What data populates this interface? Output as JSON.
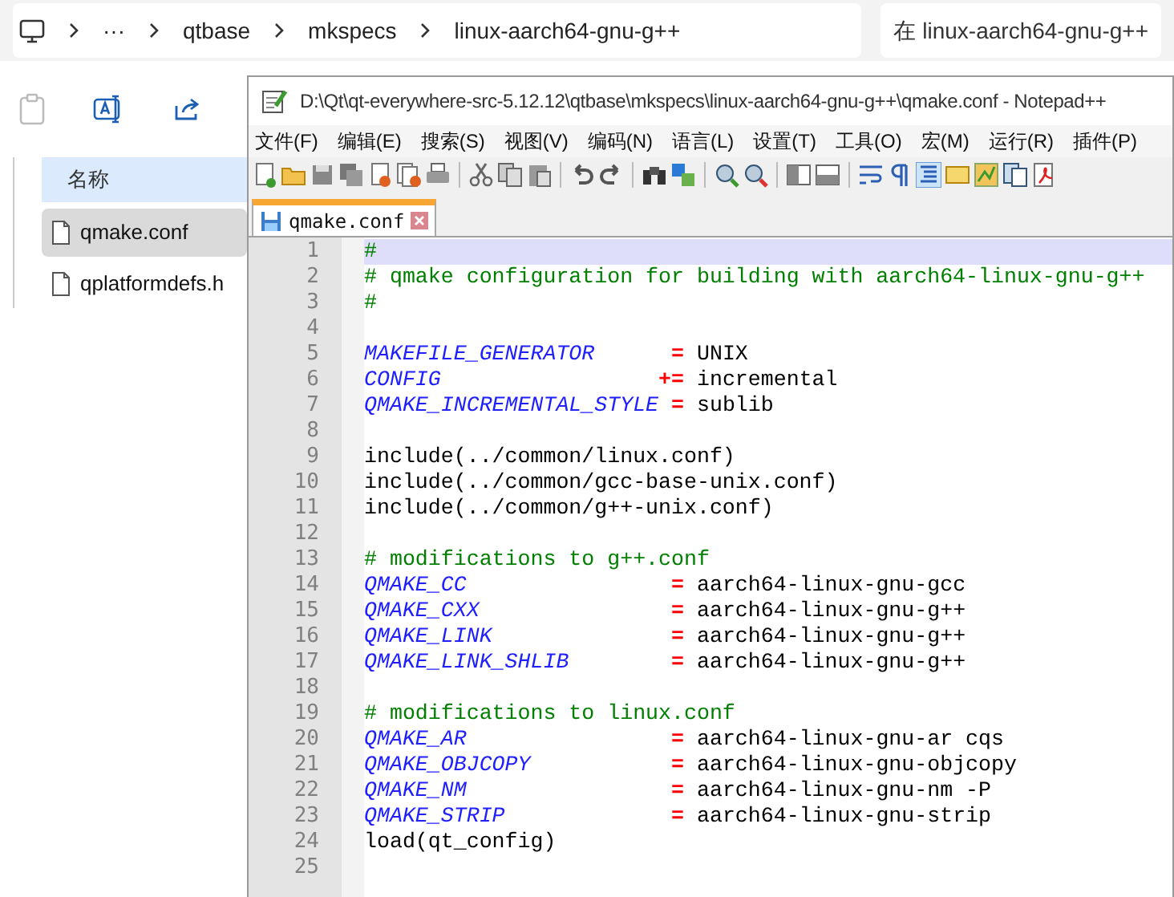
{
  "explorer": {
    "breadcrumb": [
      "···",
      "qtbase",
      "mkspecs",
      "linux-aarch64-gnu-g++"
    ],
    "search": {
      "placeholder": "在 linux-aarch64-gnu-g++"
    },
    "column_header": "名称",
    "files": [
      {
        "name": "qmake.conf",
        "selected": true
      },
      {
        "name": "qplatformdefs.h",
        "selected": false
      }
    ]
  },
  "notepad": {
    "title": "D:\\Qt\\qt-everywhere-src-5.12.12\\qtbase\\mkspecs\\linux-aarch64-gnu-g++\\qmake.conf - Notepad++",
    "menu": [
      "文件(F)",
      "编辑(E)",
      "搜索(S)",
      "视图(V)",
      "编码(N)",
      "语言(L)",
      "设置(T)",
      "工具(O)",
      "宏(M)",
      "运行(R)",
      "插件(P)"
    ],
    "tabs": [
      {
        "label": "qmake.conf",
        "selected": true
      }
    ],
    "lines": [
      {
        "number": "1",
        "current": true,
        "tokens": [
          {
            "kind": "comment",
            "text": "#"
          }
        ]
      },
      {
        "number": "2",
        "current": false,
        "tokens": [
          {
            "kind": "comment",
            "text": "# qmake configuration for building with aarch64-linux-gnu-g++"
          }
        ]
      },
      {
        "number": "3",
        "current": false,
        "tokens": [
          {
            "kind": "comment",
            "text": "#"
          }
        ]
      },
      {
        "number": "4",
        "current": false
      },
      {
        "number": "5",
        "current": false,
        "tokens": [
          {
            "kind": "var",
            "text": "MAKEFILE_GENERATOR      "
          },
          {
            "kind": "op",
            "text": "="
          },
          {
            "kind": "text",
            "text": " UNIX"
          }
        ]
      },
      {
        "number": "6",
        "current": false,
        "tokens": [
          {
            "kind": "var",
            "text": "CONFIG                 "
          },
          {
            "kind": "op",
            "text": "+="
          },
          {
            "kind": "text",
            "text": " incremental"
          }
        ]
      },
      {
        "number": "7",
        "current": false,
        "tokens": [
          {
            "kind": "var",
            "text": "QMAKE_INCREMENTAL_STYLE "
          },
          {
            "kind": "op",
            "text": "="
          },
          {
            "kind": "text",
            "text": " sublib"
          }
        ]
      },
      {
        "number": "8",
        "current": false
      },
      {
        "number": "9",
        "current": false,
        "tokens": [
          {
            "kind": "text",
            "text": "include(../common/linux.conf)"
          }
        ]
      },
      {
        "number": "10",
        "current": false,
        "tokens": [
          {
            "kind": "text",
            "text": "include(../common/gcc-base-unix.conf)"
          }
        ]
      },
      {
        "number": "11",
        "current": false,
        "tokens": [
          {
            "kind": "text",
            "text": "include(../common/g++-unix.conf)"
          }
        ]
      },
      {
        "number": "12",
        "current": false
      },
      {
        "number": "13",
        "current": false,
        "tokens": [
          {
            "kind": "comment",
            "text": "# modifications to g++.conf"
          }
        ]
      },
      {
        "number": "14",
        "current": false,
        "tokens": [
          {
            "kind": "var",
            "text": "QMAKE_CC                "
          },
          {
            "kind": "op",
            "text": "="
          },
          {
            "kind": "text",
            "text": " aarch64-linux-gnu-gcc"
          }
        ]
      },
      {
        "number": "15",
        "current": false,
        "tokens": [
          {
            "kind": "var",
            "text": "QMAKE_CXX               "
          },
          {
            "kind": "op",
            "text": "="
          },
          {
            "kind": "text",
            "text": " aarch64-linux-gnu-g++"
          }
        ]
      },
      {
        "number": "16",
        "current": false,
        "tokens": [
          {
            "kind": "var",
            "text": "QMAKE_LINK              "
          },
          {
            "kind": "op",
            "text": "="
          },
          {
            "kind": "text",
            "text": " aarch64-linux-gnu-g++"
          }
        ]
      },
      {
        "number": "17",
        "current": false,
        "tokens": [
          {
            "kind": "var",
            "text": "QMAKE_LINK_SHLIB        "
          },
          {
            "kind": "op",
            "text": "="
          },
          {
            "kind": "text",
            "text": " aarch64-linux-gnu-g++"
          }
        ]
      },
      {
        "number": "18",
        "current": false
      },
      {
        "number": "19",
        "current": false,
        "tokens": [
          {
            "kind": "comment",
            "text": "# modifications to linux.conf"
          }
        ]
      },
      {
        "number": "20",
        "current": false,
        "tokens": [
          {
            "kind": "var",
            "text": "QMAKE_AR                "
          },
          {
            "kind": "op",
            "text": "="
          },
          {
            "kind": "text",
            "text": " aarch64-linux-gnu-ar cqs"
          }
        ]
      },
      {
        "number": "21",
        "current": false,
        "tokens": [
          {
            "kind": "var",
            "text": "QMAKE_OBJCOPY           "
          },
          {
            "kind": "op",
            "text": "="
          },
          {
            "kind": "text",
            "text": " aarch64-linux-gnu-objcopy"
          }
        ]
      },
      {
        "number": "22",
        "current": false,
        "tokens": [
          {
            "kind": "var",
            "text": "QMAKE_NM                "
          },
          {
            "kind": "op",
            "text": "="
          },
          {
            "kind": "text",
            "text": " aarch64-linux-gnu-nm -P"
          }
        ]
      },
      {
        "number": "23",
        "current": false,
        "tokens": [
          {
            "kind": "var",
            "text": "QMAKE_STRIP             "
          },
          {
            "kind": "op",
            "text": "="
          },
          {
            "kind": "text",
            "text": " aarch64-linux-gnu-strip"
          }
        ]
      },
      {
        "number": "24",
        "current": false,
        "tokens": [
          {
            "kind": "text",
            "text": "load(qt_config)"
          }
        ]
      },
      {
        "number": "25",
        "current": false
      }
    ]
  }
}
